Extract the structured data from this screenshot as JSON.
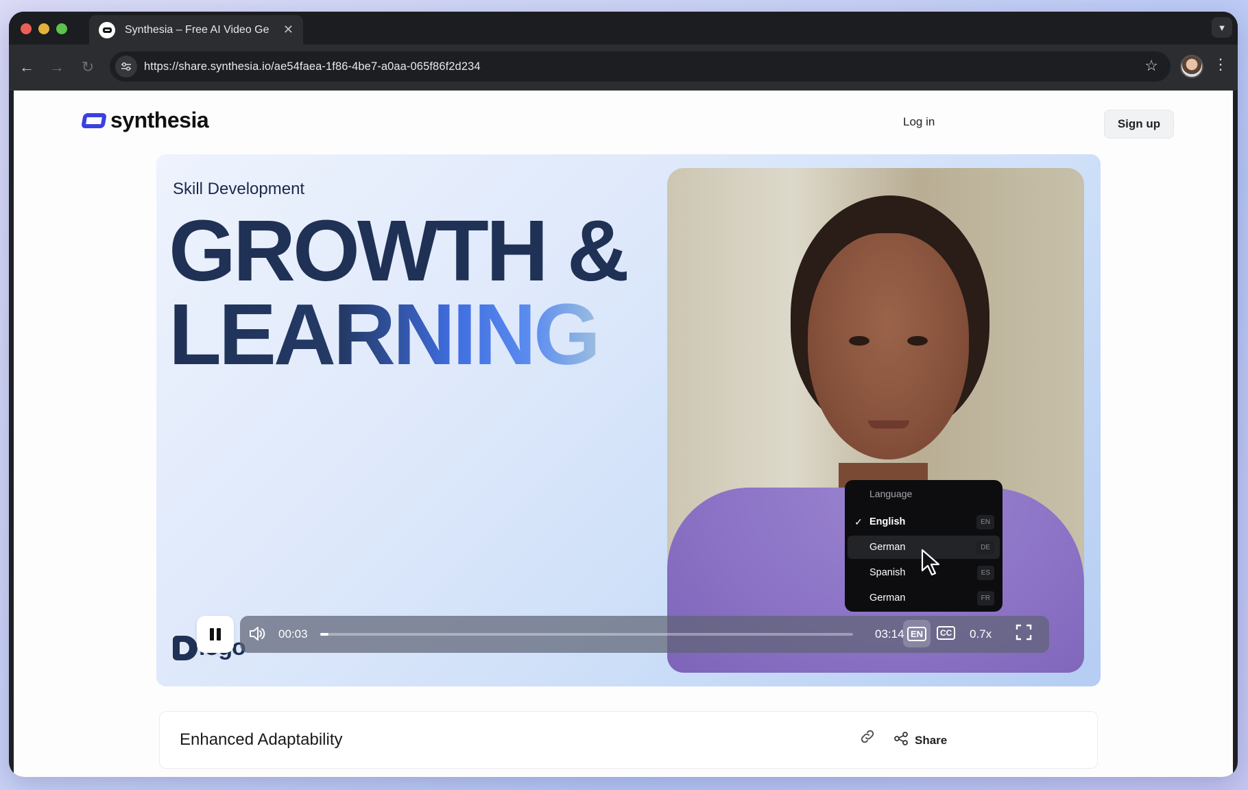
{
  "browser": {
    "tab_title": "Synthesia – Free AI Video Ge",
    "tab_close": "✕",
    "url": "https://share.synthesia.io/ae54faea-1f86-4be7-a0aa-065f86f2d234"
  },
  "header": {
    "brand": "synthesia",
    "login_label": "Log in",
    "signup_label": "Sign up"
  },
  "video": {
    "eyebrow": "Skill Development",
    "headline_line1": "GROWTH &",
    "headline_line2": "LEARNING",
    "brand_logo_text": "logo",
    "current_time": "00:03",
    "duration": "03:14",
    "progress_fraction": 0.016,
    "language_button": "EN",
    "cc_button": "CC",
    "speed": "0.7x",
    "accent_color": "#3b40e0"
  },
  "language_menu": {
    "heading": "Language",
    "items": [
      {
        "label": "English",
        "code": "EN",
        "selected": true
      },
      {
        "label": "German",
        "code": "DE",
        "hovered": true
      },
      {
        "label": "Spanish",
        "code": "ES"
      },
      {
        "label": "German",
        "code": "FR"
      }
    ]
  },
  "card": {
    "title": "Enhanced Adaptability",
    "share_label": "Share"
  }
}
